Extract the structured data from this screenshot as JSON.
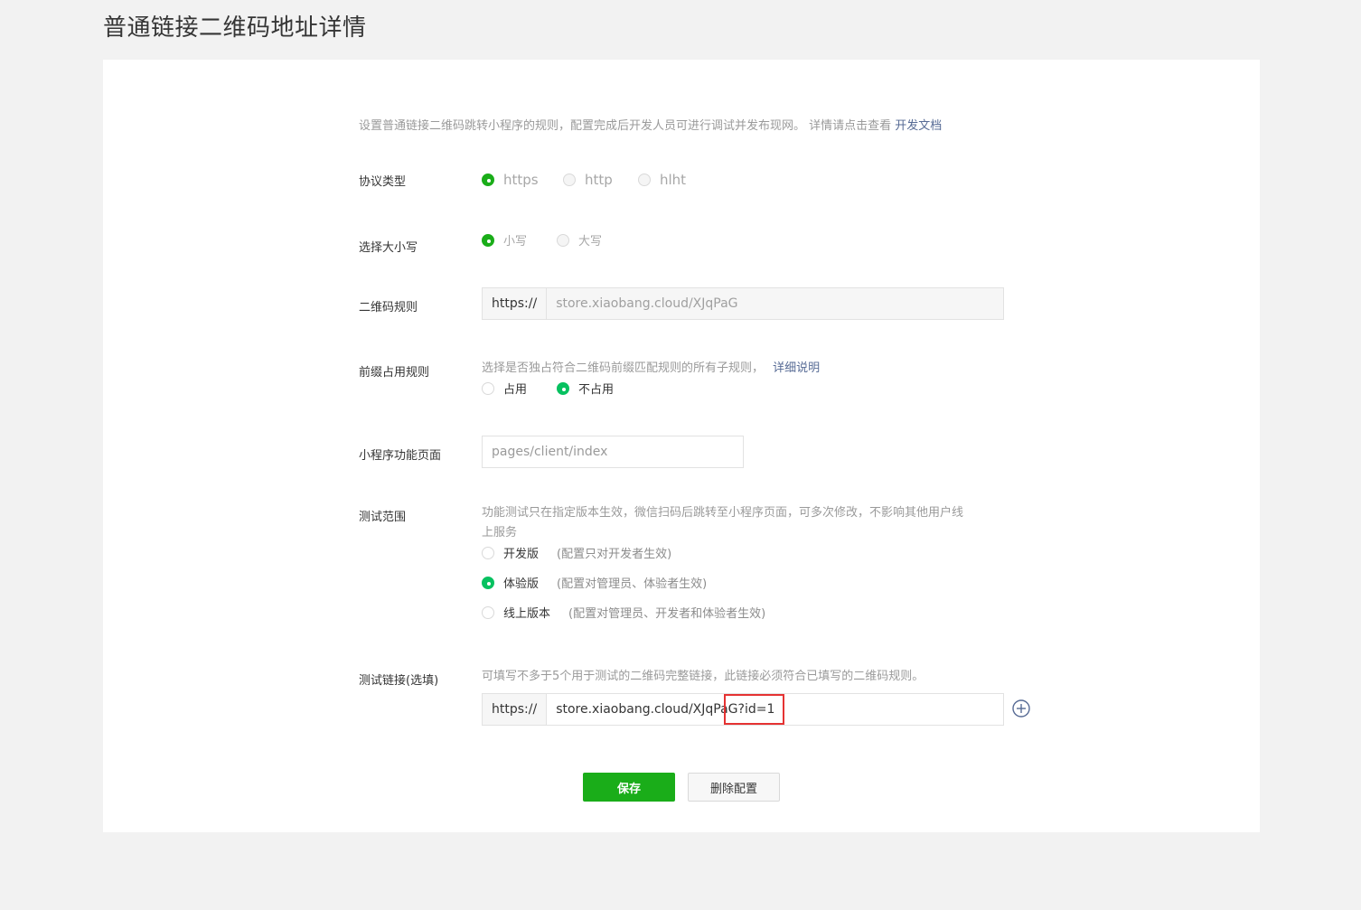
{
  "page_title": "普通链接二维码地址详情",
  "intro": {
    "text": "设置普通链接二维码跳转小程序的规则，配置完成后开发人员可进行调试并发布现网。 详情请点击查看 ",
    "link": "开发文档"
  },
  "protocol": {
    "label": "协议类型",
    "options": [
      "https",
      "http",
      "hlht"
    ],
    "selected": "https"
  },
  "case": {
    "label": "选择大小写",
    "options": [
      "小写",
      "大写"
    ],
    "selected": "小写"
  },
  "qr_rule": {
    "label": "二维码规则",
    "prefix": "https://",
    "value": "store.xiaobang.cloud/XJqPaG"
  },
  "prefix_rule": {
    "label": "前缀占用规则",
    "desc": "选择是否独占符合二维码前缀匹配规则的所有子规则，",
    "link": "详细说明",
    "options": [
      "占用",
      "不占用"
    ],
    "selected": "不占用"
  },
  "page_path": {
    "label": "小程序功能页面",
    "value": "pages/client/index"
  },
  "test_scope": {
    "label": "测试范围",
    "desc_line1": "功能测试只在指定版本生效，微信扫码后跳转至小程序页面，可多次修改，不影响其他用户线",
    "desc_line2": "上服务",
    "options": [
      {
        "label": "开发版",
        "hint": "(配置只对开发者生效)"
      },
      {
        "label": "体验版",
        "hint": "(配置对管理员、体验者生效)"
      },
      {
        "label": "线上版本",
        "hint": "(配置对管理员、开发者和体验者生效)"
      }
    ],
    "selected": "体验版"
  },
  "test_link": {
    "label": "测试链接(选填)",
    "desc": "可填写不多于5个用于测试的二维码完整链接，此链接必须符合已填写的二维码规则。",
    "prefix": "https://",
    "value": "store.xiaobang.cloud/XJqPaG?id=1"
  },
  "buttons": {
    "save": "保存",
    "delete": "删除配置"
  },
  "colors": {
    "brand_green": "#1aad19",
    "link_blue": "#576b95",
    "highlight_red": "#e53333"
  }
}
